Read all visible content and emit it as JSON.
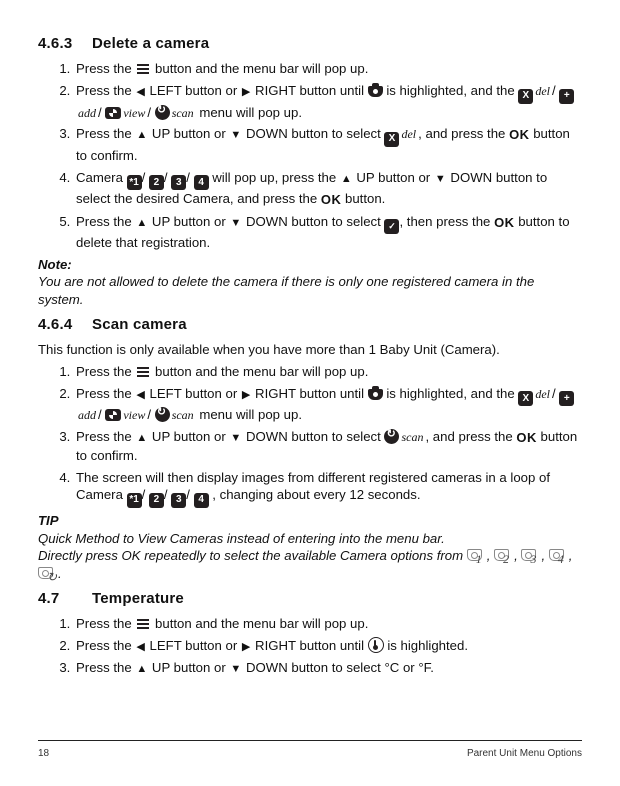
{
  "sections": {
    "s463": {
      "num": "4.6.3",
      "title": "Delete a camera"
    },
    "s464": {
      "num": "4.6.4",
      "title": "Scan camera"
    },
    "s47": {
      "num": "4.7",
      "title": "Temperature"
    }
  },
  "s463_steps": {
    "1a": "Press the ",
    "1b": " button and the menu bar will pop up.",
    "2a": "Press the ",
    "2b": " LEFT button or ",
    "2c": " RIGHT button until ",
    "2d": " is highlighted, and the ",
    "2e": " menu will pop up.",
    "3a": "Press the ",
    "3b": " UP button or ",
    "3c": " DOWN button to select ",
    "3d": ", and press the ",
    "3e": " button to confirm.",
    "4a": "Camera ",
    "4b": " will pop up, press the ",
    "4c": " UP button or ",
    "4d": " DOWN button to select the desired Camera, and press the ",
    "4e": " button.",
    "5a": "Press the ",
    "5b": " UP button or ",
    "5c": " DOWN button to select ",
    "5d": ", then press the ",
    "5e": " button to delete that registration."
  },
  "s463_note": {
    "head": "Note:",
    "body": "You are not allowed to delete the camera if there is only one registered camera in the system."
  },
  "s464_intro": "This function is only available when you have more than 1 Baby Unit (Camera).",
  "s464_steps": {
    "1a": "Press the ",
    "1b": " button and the menu bar will pop up.",
    "2a": "Press the ",
    "2b": " LEFT button or ",
    "2c": " RIGHT button until ",
    "2d": " is highlighted, and the ",
    "2e": " menu will pop up.",
    "3a": "Press the ",
    "3b": " UP button or ",
    "3c": " DOWN button to select ",
    "3d": ", and press the ",
    "3e": " button to confirm.",
    "4a": "The screen will then display images from different registered cameras in a loop of Camera ",
    "4b": " , changing about every 12 seconds."
  },
  "s464_tip": {
    "head": "TIP",
    "line1": "Quick Method to View Cameras instead of entering into the menu bar.",
    "line2a": "Directly press OK repeatedly to select the available Camera options from ",
    "line2b": "."
  },
  "s47_steps": {
    "1a": "Press the ",
    "1b": " button and the menu bar will pop up.",
    "2a": "Press the ",
    "2b": " LEFT button or ",
    "2c": " RIGHT button until ",
    "2d": " is highlighted.",
    "3a": "Press the ",
    "3b": " UP button or ",
    "3c": " DOWN button to select °C or °F."
  },
  "labels": {
    "del": "del",
    "add": "add",
    "view": "view",
    "scan": "scan",
    "sep": "/",
    "comma": ", ",
    "ok": "OK"
  },
  "cams": {
    "c1": "*1",
    "c2": "2",
    "c3": "3",
    "c4": "4"
  },
  "footer": {
    "page": "18",
    "title": "Parent Unit Menu Options"
  }
}
